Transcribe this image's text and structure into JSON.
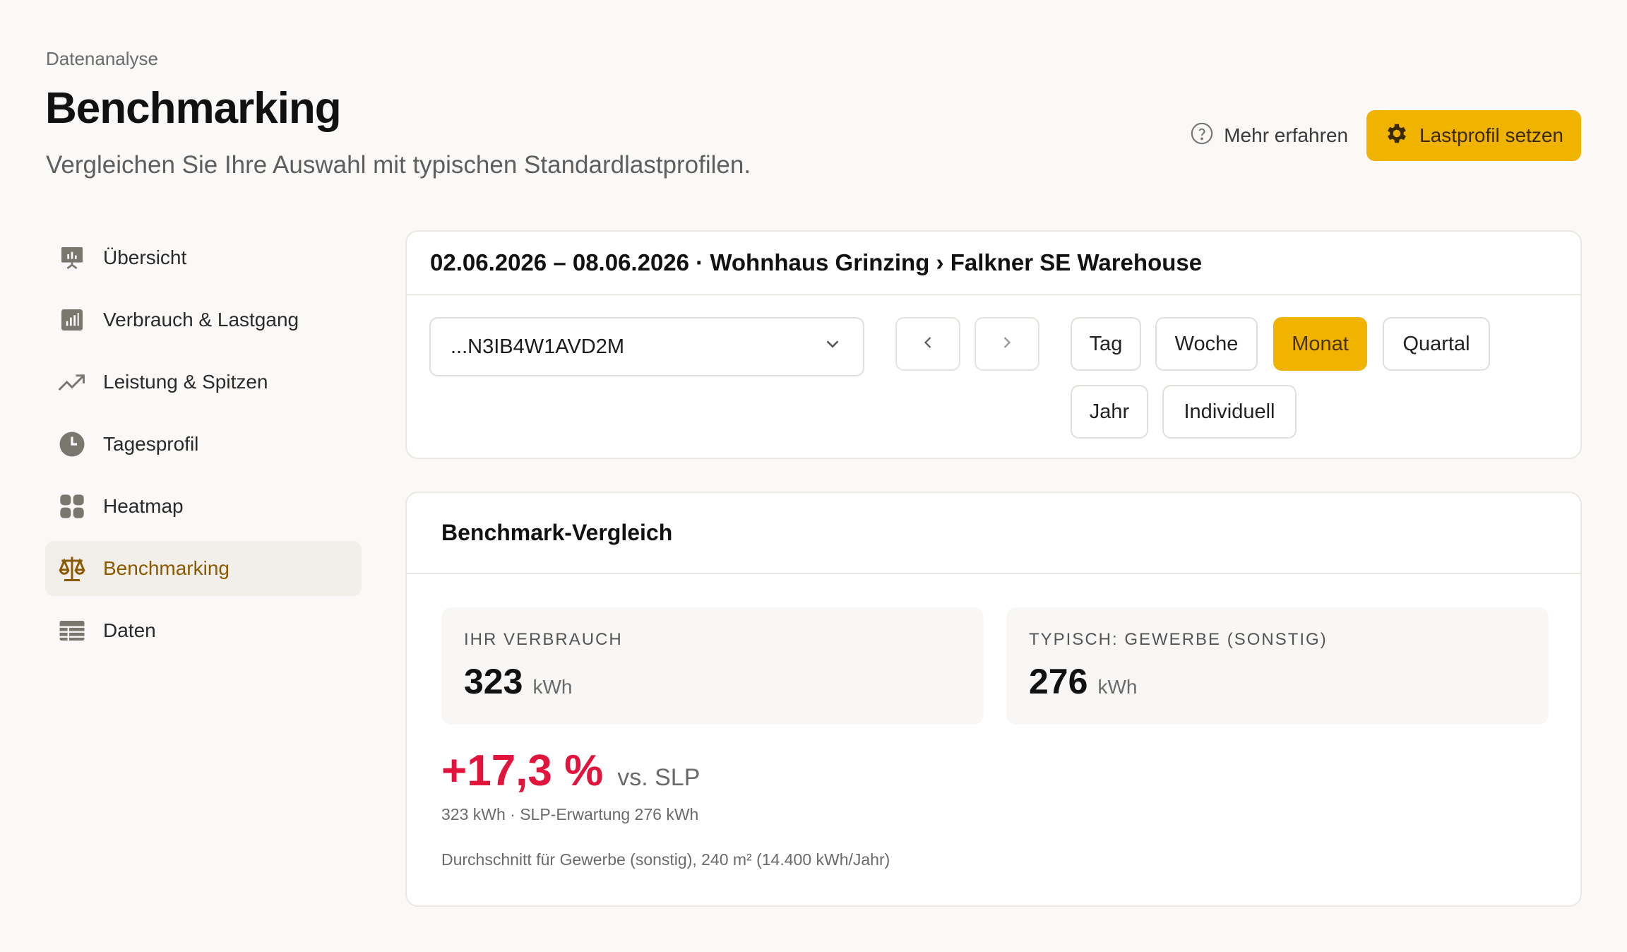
{
  "header": {
    "breadcrumb": "Datenanalyse",
    "title": "Benchmarking",
    "subtitle": "Vergleichen Sie Ihre Auswahl mit typischen Standardlastprofilen.",
    "learn_more": "Mehr erfahren",
    "primary_action": "Lastprofil setzen",
    "accent_color": "#f0b400"
  },
  "sidebar": {
    "items": [
      {
        "label": "Übersicht",
        "icon": "presentation-chart-icon"
      },
      {
        "label": "Verbrauch & Lastgang",
        "icon": "bar-chart-icon"
      },
      {
        "label": "Leistung & Spitzen",
        "icon": "trend-up-icon"
      },
      {
        "label": "Tagesprofil",
        "icon": "clock-icon"
      },
      {
        "label": "Heatmap",
        "icon": "grid-icon"
      },
      {
        "label": "Benchmarking",
        "icon": "scale-icon",
        "active": true
      },
      {
        "label": "Daten",
        "icon": "table-icon"
      }
    ]
  },
  "filter": {
    "title": "02.06.2026 – 08.06.2026 · Wohnhaus Grinzing › Falkner SE Warehouse",
    "meter_value": "...N3IB4W1AVD2M",
    "periods": [
      "Tag",
      "Woche",
      "Monat",
      "Quartal",
      "Jahr",
      "Individuell"
    ],
    "active_period": "Monat"
  },
  "benchmark": {
    "title": "Benchmark-Vergleich",
    "yours": {
      "label": "IHR VERBRAUCH",
      "value": "323",
      "unit": "kWh"
    },
    "typical": {
      "label": "TYPISCH: GEWERBE (SONSTIG)",
      "value": "276",
      "unit": "kWh"
    },
    "delta": "+17,3 %",
    "delta_suffix": "vs. SLP",
    "delta_color": "#e0143c",
    "detail": "323 kWh · SLP-Erwartung 276 kWh",
    "note": "Durchschnitt für Gewerbe (sonstig), 240 m² (14.400 kWh/Jahr)"
  }
}
